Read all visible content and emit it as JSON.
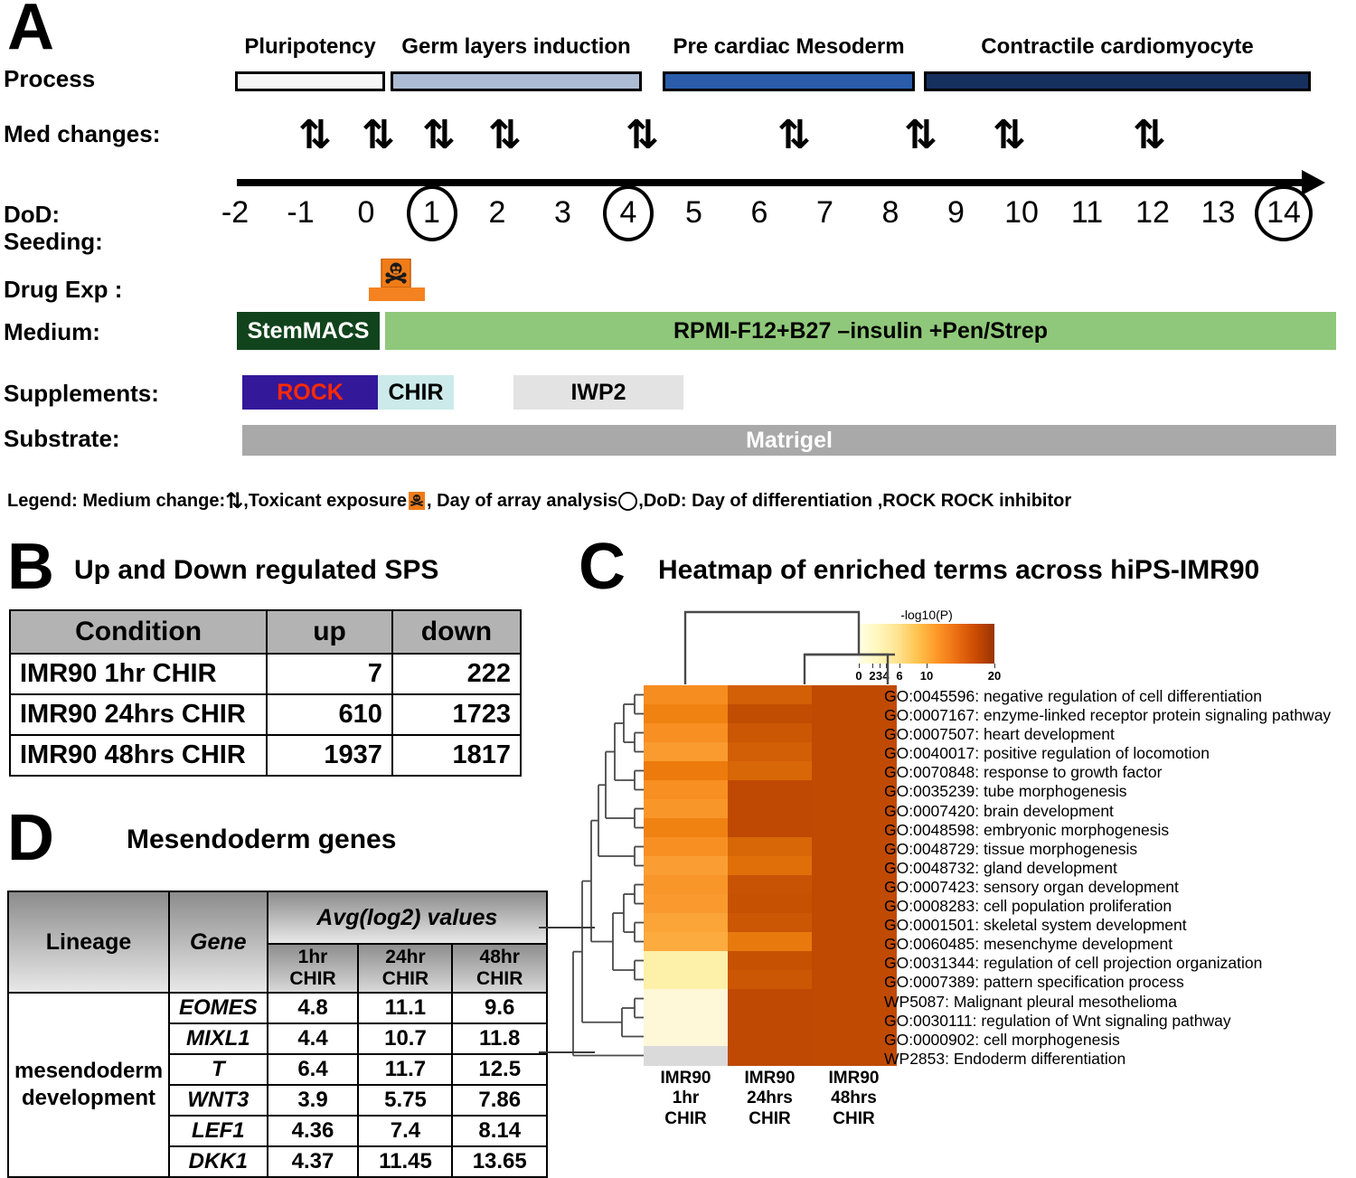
{
  "panelA": {
    "letter": "A",
    "row_labels": [
      "Process",
      "Med changes:",
      "DoD:",
      "Seeding:",
      "Drug Exp  :",
      "Medium:",
      "Supplements:",
      "Substrate:"
    ],
    "processes": [
      {
        "name": "Pluripotency",
        "color": "#f7f7f7"
      },
      {
        "name": "Germ layers induction",
        "color": "#adbcd4"
      },
      {
        "name": "Pre cardiac Mesoderm",
        "color": "#2a5caa"
      },
      {
        "name": "Contractile cardiomyocyte",
        "color": "#16305e"
      }
    ],
    "med_change_symbol": "⇅",
    "med_change_count": 9,
    "dod_ticks": [
      "-2",
      "-1",
      "0",
      "1",
      "2",
      "3",
      "4",
      "5",
      "6",
      "7",
      "8",
      "9",
      "10",
      "11",
      "12",
      "13",
      "14"
    ],
    "dod_circled": [
      "1",
      "4",
      "14"
    ],
    "drug_exposure_icon": "toxicant-hazard-icon",
    "media": [
      {
        "label": "StemMACS",
        "color": "#11441c",
        "text_color": "#ffffff"
      },
      {
        "label": "RPMI-F12+B27 –insulin +Pen/Strep",
        "color": "#8fc87a",
        "text_color": "#000000"
      }
    ],
    "supplements": [
      {
        "label": "ROCK",
        "color": "#34189a",
        "text_color": "#ff2a00"
      },
      {
        "label": "CHIR",
        "color": "#cceaea",
        "text_color": "#000000"
      },
      {
        "label": "IWP2",
        "color": "#e3e3e3",
        "text_color": "#000000"
      }
    ],
    "substrate": {
      "label": "Matrigel",
      "color": "#a9a9a9",
      "text_color": "#ffffff"
    },
    "legend": {
      "prefix": "Legend: Medium change:",
      "symbol": "⇅",
      "mid1": ",Toxicant exposure",
      "icon": "toxicant-hazard-icon",
      "mid2": ", Day of array analysis",
      "circle": "◯",
      "suffix": ",DoD: Day of differentiation ,ROCK   ROCK inhibitor"
    }
  },
  "panelB": {
    "letter": "B",
    "title": "Up and Down regulated SPS",
    "columns": [
      "Condition",
      "up",
      "down"
    ],
    "rows": [
      [
        "IMR90 1hr CHIR",
        "7",
        "222"
      ],
      [
        "IMR90 24hrs CHIR",
        "610",
        "1723"
      ],
      [
        "IMR90 48hrs CHIR",
        "1937",
        "1817"
      ]
    ]
  },
  "panelC": {
    "letter": "C",
    "title": "Heatmap of enriched terms across hiPS-IMR90",
    "chart_data": {
      "type": "heatmap",
      "title": "Heatmap of enriched terms across hiPS-IMR90",
      "colorbar_title": "-log10(P)",
      "colorbar_ticks": [
        "0",
        "2",
        "3",
        "4",
        "6",
        "10",
        "20"
      ],
      "colorbar_tick_values": [
        0,
        2,
        3,
        4,
        6,
        10,
        20
      ],
      "colorbar_range": [
        0,
        20
      ],
      "colorbar_colors": [
        "#ffffe5",
        "#fff7bc",
        "#fee391",
        "#fec44f",
        "#fe9929",
        "#ec7014",
        "#cc4c02",
        "#993404"
      ],
      "columns": [
        "IMR90\n1hr\nCHIR",
        "IMR90\n24hrs\nCHIR",
        "IMR90\n48hrs\nCHIR"
      ],
      "column_labels": [
        {
          "l1": "IMR90",
          "l2": "1hr",
          "l3": "CHIR"
        },
        {
          "l1": "IMR90",
          "l2": "24hrs",
          "l3": "CHIR"
        },
        {
          "l1": "IMR90",
          "l2": "48hrs",
          "l3": "CHIR"
        }
      ],
      "rows": [
        "GO:0045596: negative regulation of cell differentiation",
        "GO:0007167: enzyme-linked receptor protein signaling pathway",
        "GO:0007507: heart development",
        "GO:0040017: positive regulation of locomotion",
        "GO:0070848: response to growth factor",
        "GO:0035239: tube morphogenesis",
        "GO:0007420: brain development",
        "GO:0048598: embryonic morphogenesis",
        "GO:0048729: tissue morphogenesis",
        "GO:0048732: gland development",
        "GO:0007423: sensory organ development",
        "GO:0008283: cell population proliferation",
        "GO:0001501: skeletal system development",
        "GO:0060485: mesenchyme development",
        "GO:0031344: regulation of cell projection organization",
        "GO:0007389: pattern specification process",
        "WP5087: Malignant pleural mesothelioma",
        "GO:0030111: regulation of Wnt signaling pathway",
        "GO:0000902: cell morphogenesis",
        "WP2853: Endoderm differentiation"
      ],
      "values": [
        [
          9.5,
          14.0,
          20.0
        ],
        [
          10.5,
          17.5,
          20.0
        ],
        [
          9.0,
          15.5,
          20.0
        ],
        [
          8.5,
          13.5,
          20.0
        ],
        [
          12.5,
          13.0,
          20.0
        ],
        [
          9.0,
          18.5,
          20.0
        ],
        [
          8.5,
          18.5,
          20.0
        ],
        [
          10.5,
          18.5,
          20.0
        ],
        [
          9.0,
          13.0,
          20.0
        ],
        [
          8.0,
          12.0,
          20.0
        ],
        [
          9.0,
          16.0,
          20.0
        ],
        [
          8.5,
          16.5,
          20.0
        ],
        [
          8.0,
          15.5,
          20.0
        ],
        [
          7.5,
          11.5,
          20.0
        ],
        [
          3.0,
          17.5,
          20.0
        ],
        [
          3.0,
          15.5,
          20.0
        ],
        [
          2.2,
          18.5,
          20.0
        ],
        [
          2.0,
          18.5,
          20.0
        ],
        [
          2.0,
          18.5,
          20.0
        ],
        [
          0.0,
          18.5,
          20.0
        ]
      ],
      "cell_colors": [
        [
          "#f68d20",
          "#d35f06",
          "#c04a02"
        ],
        [
          "#f08211",
          "#c14d02",
          "#c04a02"
        ],
        [
          "#f88f22",
          "#cb5603",
          "#c04a02"
        ],
        [
          "#f99b2f",
          "#d25e06",
          "#c04a02"
        ],
        [
          "#ed7a0c",
          "#d86707",
          "#c04a02"
        ],
        [
          "#f88f22",
          "#bf4902",
          "#c04a02"
        ],
        [
          "#f9962a",
          "#bf4902",
          "#c04a02"
        ],
        [
          "#f08211",
          "#bf4902",
          "#c04a02"
        ],
        [
          "#f88f22",
          "#d86707",
          "#c04a02"
        ],
        [
          "#fa9e33",
          "#e06f09",
          "#c04a02"
        ],
        [
          "#f9962a",
          "#c85304",
          "#c04a02"
        ],
        [
          "#fa9a2e",
          "#c65103",
          "#c04a02"
        ],
        [
          "#fba437",
          "#cb5603",
          "#c04a02"
        ],
        [
          "#fcab3f",
          "#e87a0d",
          "#c04a02"
        ],
        [
          "#fdf0a8",
          "#c65103",
          "#c04a02"
        ],
        [
          "#fdf0a8",
          "#cb5603",
          "#c04a02"
        ],
        [
          "#fef8d8",
          "#bf4902",
          "#c04a02"
        ],
        [
          "#fef8d8",
          "#bf4902",
          "#c04a02"
        ],
        [
          "#fef8d8",
          "#bf4902",
          "#c04a02"
        ],
        [
          "#dadada",
          "#bf4902",
          "#c04a02"
        ]
      ]
    }
  },
  "panelD": {
    "letter": "D",
    "title": "Mesendoderm genes",
    "header_lineage": "Lineage",
    "header_gene": "Gene",
    "header_group": "Avg(log2) values",
    "sub_columns": [
      "1hr CHIR",
      "24hr CHIR",
      "48hr CHIR"
    ],
    "lineage_line1": "mesendoderm",
    "lineage_line2": "development",
    "rows": [
      {
        "gene": "EOMES",
        "values": [
          "4.8",
          "11.1",
          "9.6"
        ]
      },
      {
        "gene": "MIXL1",
        "values": [
          "4.4",
          "10.7",
          "11.8"
        ]
      },
      {
        "gene": "T",
        "values": [
          "6.4",
          "11.7",
          "12.5"
        ]
      },
      {
        "gene": "WNT3",
        "values": [
          "3.9",
          "5.75",
          "7.86"
        ]
      },
      {
        "gene": "LEF1",
        "values": [
          "4.36",
          "7.4",
          "8.14"
        ]
      },
      {
        "gene": "DKK1",
        "values": [
          "4.37",
          "11.45",
          "13.65"
        ]
      }
    ]
  }
}
